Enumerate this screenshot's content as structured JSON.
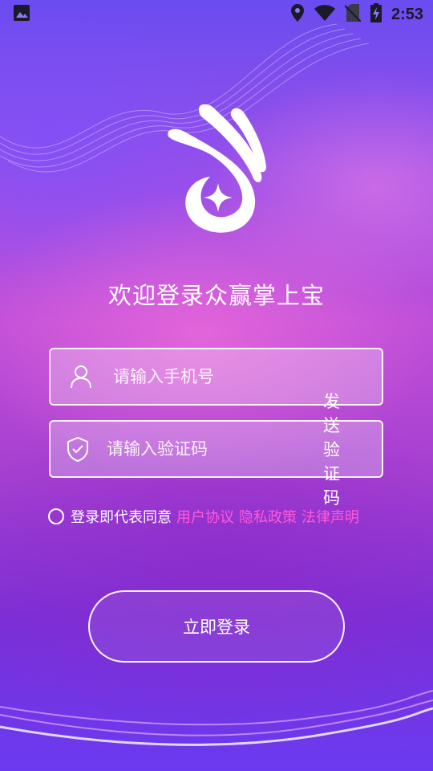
{
  "status_bar": {
    "time": "2:53",
    "icons": [
      "image-icon",
      "location-icon",
      "wifi-icon",
      "no-sim-icon",
      "battery-charging-icon"
    ]
  },
  "app": {
    "welcome": "欢迎登录众赢掌上宝"
  },
  "form": {
    "phone": {
      "placeholder": "请输入手机号",
      "value": "",
      "icon": "user-icon"
    },
    "code": {
      "placeholder": "请输入验证码",
      "value": "",
      "icon": "shield-check-icon",
      "send_label": "发送验证码"
    },
    "agreement": {
      "checked": false,
      "text": "登录即代表同意",
      "links": [
        "用户协议",
        "隐私政策",
        "法律声明"
      ]
    },
    "submit_label": "立即登录"
  },
  "colors": {
    "link": "#ff5ad8",
    "text": "#ffffff",
    "background_top": "#6a4cf0",
    "background_mid": "#c04fd8",
    "background_bottom": "#6b3af0"
  }
}
